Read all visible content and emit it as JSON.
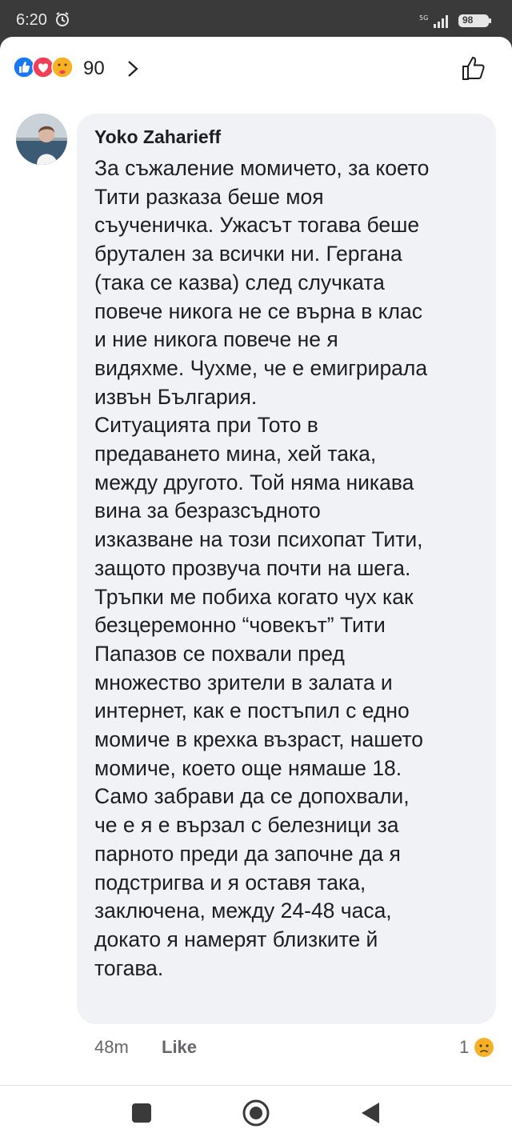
{
  "status_bar": {
    "time": "6:20",
    "network": "5G",
    "battery": "98"
  },
  "reactions": {
    "count": "90",
    "icons": [
      "like-icon",
      "love-icon",
      "care-icon"
    ]
  },
  "comment": {
    "author": "Yoko Zaharieff",
    "lines": [
      "За съжаление момичето, за което",
      "Тити разказа беше моя",
      "съученичка. Ужасът тогава беше",
      "брутален за всички ни. Гергана",
      "(така се казва) след случката",
      "повече никога не се върна в клас",
      "и ние никога повече не я",
      "видяхме. Чухме, че е емигрирала",
      "извън България.",
      "Ситуацията при Тото в",
      "предаването мина, хей така,",
      "между другото. Той няма никава",
      "вина за безразсъдното",
      "изказване на този психопат Тити,",
      "защото прозвуча почти на шега.",
      "Тръпки ме побиха когато чух как",
      "безцеремонно “човекът” Тити",
      "Папазов се похвали пред",
      "множество зрители в залата и",
      "интернет, как е постъпил с едно",
      "момиче в крехка възраст, нашето",
      "момиче, което още нямаше 18.",
      "Само забрави да се допохвали,",
      "че е я е вързал с белезници за",
      "парното преди да започне да я",
      "подстригва и я оставя така,",
      "заключена, между 24-48 часа,",
      "докато я намерят близките й",
      "тогава."
    ],
    "time": "48m",
    "like_label": "Like",
    "reaction_count": "1",
    "reaction_icon": "sad-icon"
  },
  "colors": {
    "like_blue": "#1877f2",
    "love_red": "#f33e58",
    "care_yellow": "#f7b125",
    "bubble_bg": "#f0f2f5",
    "meta_gray": "#65676b"
  }
}
